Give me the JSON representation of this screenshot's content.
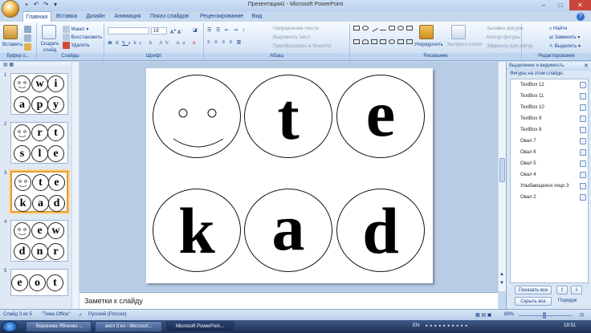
{
  "window": {
    "title": "Презентация1 - Microsoft PowerPoint"
  },
  "tabs": [
    "Главная",
    "Вставка",
    "Дизайн",
    "Анимация",
    "Показ слайдов",
    "Рецензирование",
    "Вид"
  ],
  "ribbon": {
    "clipboard": {
      "paste": "Вставить",
      "label": "Буфер о..."
    },
    "slides": {
      "create": "Создать слайд",
      "layout": "Макет",
      "restore": "Восстановить",
      "delete": "Удалить",
      "label": "Слайды"
    },
    "font": {
      "size": "18",
      "label": "Шрифт"
    },
    "paragraph": {
      "direction": "Направление текста",
      "align": "Выровнять текст",
      "smartart": "Преобразовать в SmartArt",
      "label": "Абзац"
    },
    "drawing": {
      "arrange": "Упорядочить",
      "styles": "Экспресс-стили",
      "fill": "Заливка фигуры",
      "outline": "Контур фигуры",
      "effects": "Эффекты для фигур",
      "label": "Рисование"
    },
    "editing": {
      "find": "Найти",
      "replace": "Заменить",
      "select": "Выделить",
      "label": "Редактирование"
    }
  },
  "thumbnails": [
    {
      "num": "1",
      "letters": [
        "w",
        "i",
        "a",
        "p",
        "y"
      ]
    },
    {
      "num": "2",
      "letters": [
        "r",
        "t",
        "s",
        "l",
        "e"
      ]
    },
    {
      "num": "3",
      "letters": [
        "t",
        "e",
        "k",
        "a",
        "d"
      ]
    },
    {
      "num": "4",
      "letters": [
        "e",
        "w",
        "d",
        "n",
        "r"
      ]
    },
    {
      "num": "5",
      "letters": [
        "e",
        "o",
        "t"
      ]
    }
  ],
  "slide": {
    "letters": [
      "t",
      "e",
      "k",
      "a",
      "d"
    ]
  },
  "notes": {
    "placeholder": "Заметки к слайду"
  },
  "selection_pane": {
    "title": "Выделение и видимость",
    "subtitle": "Фигуры на этом слайде:",
    "items": [
      "TextBox 12",
      "TextBox 11",
      "TextBox 10",
      "TextBox 9",
      "TextBox 8",
      "Овал 7",
      "Овал 6",
      "Овал 5",
      "Овал 4",
      "Улыбающееся лицо 3",
      "Овал 2"
    ],
    "show_all": "Показать все",
    "hide_all": "Скрыть все",
    "order": "Порядок"
  },
  "status": {
    "slide": "Слайд 3 из 5",
    "theme": "\"Тема Office\"",
    "language": "Русский (Россия)",
    "zoom": "69%"
  },
  "taskbar": {
    "items": [
      "Вероника Ябченко ...",
      "англ 3 кл - Microsof...",
      "Microsoft PowerPoin..."
    ],
    "lang": "EN",
    "time": "19:31"
  }
}
